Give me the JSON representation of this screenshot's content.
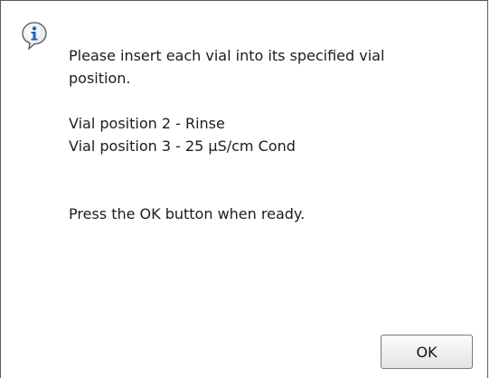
{
  "dialog": {
    "icon": "info-icon",
    "message_lines": [
      "Please insert each vial into its specified vial",
      "position.",
      "Vial position 2 - Rinse",
      "Vial position 3 - 25 µS/cm Cond",
      "Press the OK button when ready."
    ],
    "ok_label": "OK"
  },
  "colors": {
    "icon_blue": "#1f5fbf",
    "border": "#5a5a5a"
  }
}
